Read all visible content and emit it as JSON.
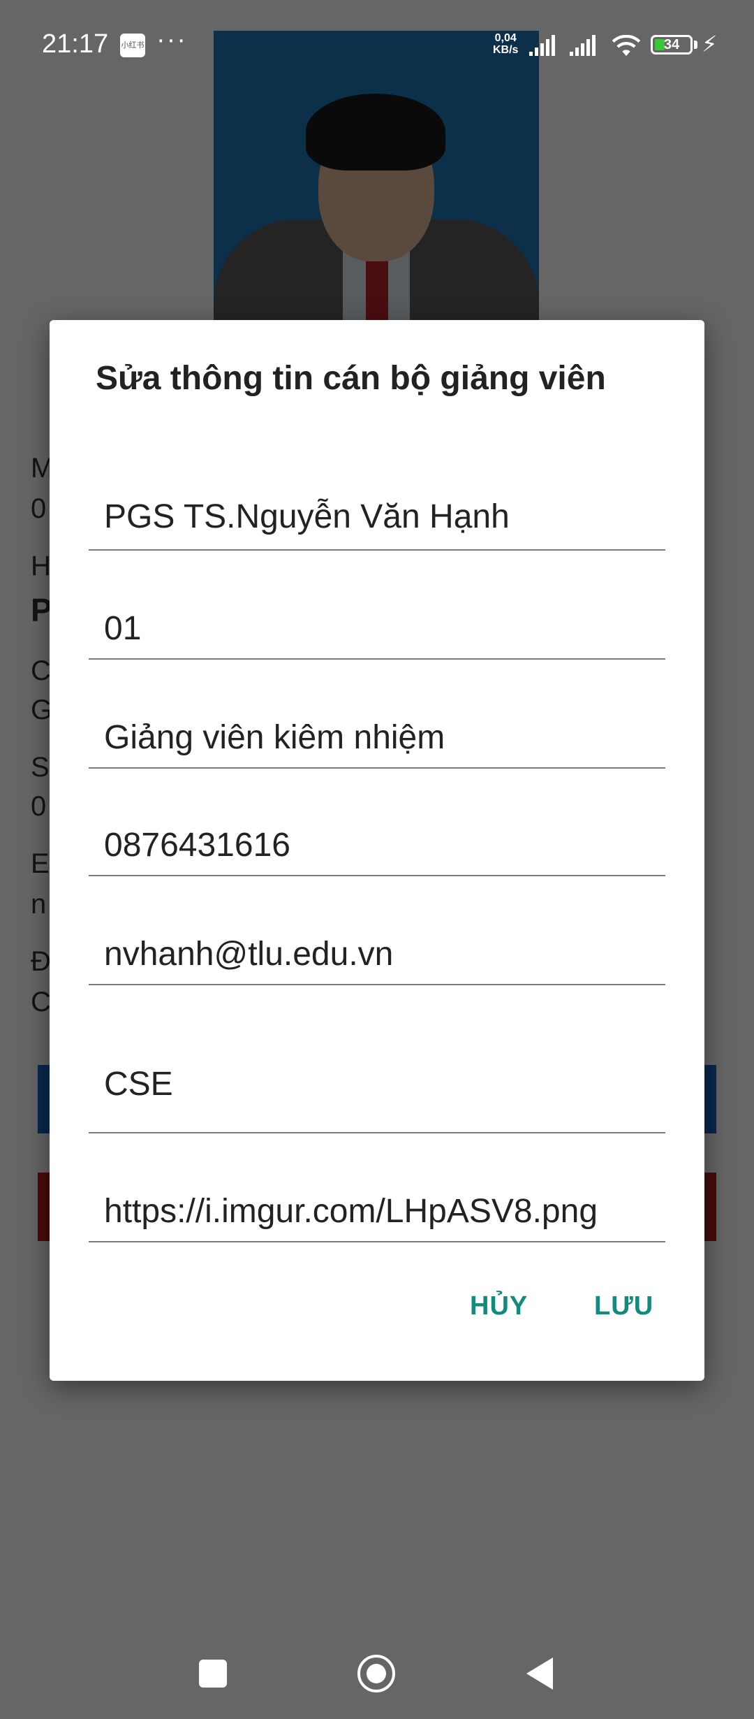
{
  "status_bar": {
    "time": "21:17",
    "notification_badge": "小红书",
    "more": "···",
    "net_speed_value": "0,04",
    "net_speed_unit": "KB/s",
    "battery_level": "34"
  },
  "background_page": {
    "info_fragments": [
      "M",
      "0",
      "H",
      "P",
      "C",
      "G",
      "S",
      "0",
      "E",
      "n",
      "Đ",
      "C"
    ],
    "button_colors": [
      "#1565c0",
      "#b71c1c"
    ]
  },
  "dialog": {
    "title": "Sửa thông tin cán bộ giảng viên",
    "fields": [
      {
        "value": "PGS TS.Nguyễn Văn Hạnh"
      },
      {
        "value": "01"
      },
      {
        "value": "Giảng viên kiêm nhiệm"
      },
      {
        "value": "0876431616"
      },
      {
        "value": "nvhanh@tlu.edu.vn"
      },
      {
        "value": "CSE"
      },
      {
        "value": "https://i.imgur.com/LHpASV8.png"
      }
    ],
    "cancel_label": "HỦY",
    "save_label": "LƯU",
    "accent_color": "#138a7e"
  }
}
